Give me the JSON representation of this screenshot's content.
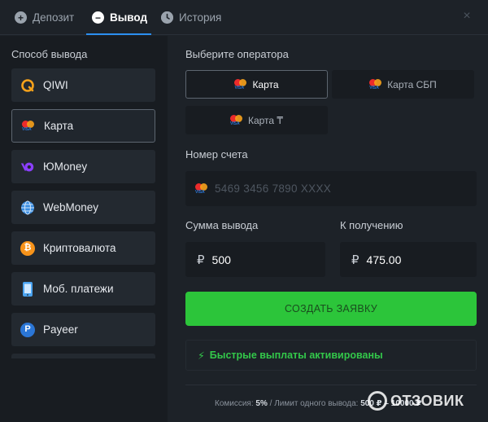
{
  "tabs": [
    {
      "label": "Депозит",
      "icon": "plus-circle-icon"
    },
    {
      "label": "Вывод",
      "icon": "minus-circle-icon",
      "active": true
    },
    {
      "label": "История",
      "icon": "clock-icon"
    }
  ],
  "close_icon": "×",
  "left": {
    "title": "Способ вывода",
    "methods": [
      {
        "label": "QIWI",
        "icon": "qiwi-icon",
        "color": "#f7a21b"
      },
      {
        "label": "Карта",
        "icon": "card-icon",
        "active": true
      },
      {
        "label": "ЮMoney",
        "icon": "yoomoney-icon",
        "color": "#8b3ffd"
      },
      {
        "label": "WebMoney",
        "icon": "webmoney-icon",
        "color": "#3a8de0"
      },
      {
        "label": "Криптовалюта",
        "icon": "bitcoin-icon",
        "color": "#f7931a"
      },
      {
        "label": "Моб. платежи",
        "icon": "phone-icon",
        "color": "#4aa3f0"
      },
      {
        "label": "Payeer",
        "icon": "payeer-icon",
        "color": "#2b76d6"
      }
    ]
  },
  "operator": {
    "title": "Выберите оператора",
    "options": [
      {
        "label": "Карта",
        "active": true
      },
      {
        "label": "Карта СБП"
      },
      {
        "label": "Карта ₸"
      }
    ]
  },
  "account": {
    "label": "Номер счета",
    "placeholder": "5469 3456 7890 XXXX"
  },
  "amount": {
    "label": "Сумма вывода",
    "currency": "₽",
    "value": "500"
  },
  "receive": {
    "label": "К получению",
    "currency": "₽",
    "value": "475.00"
  },
  "submit_label": "СОЗДАТЬ ЗАЯВКУ",
  "fast_payouts": {
    "icon": "⚡",
    "text": "Быстрые выплаты активированы"
  },
  "footer": {
    "commission_label": "Комиссия:",
    "commission_value": "5%",
    "separator": "/",
    "limit_label": "Лимит одного вывода:",
    "limit_value": "500 ₽ – 10000 ₽"
  },
  "watermark": "ОТЗОВИК",
  "colors": {
    "accent": "#2b8ff0",
    "submit": "#2cc53a",
    "fast_text": "#33c84a",
    "background": "#1d2228"
  }
}
